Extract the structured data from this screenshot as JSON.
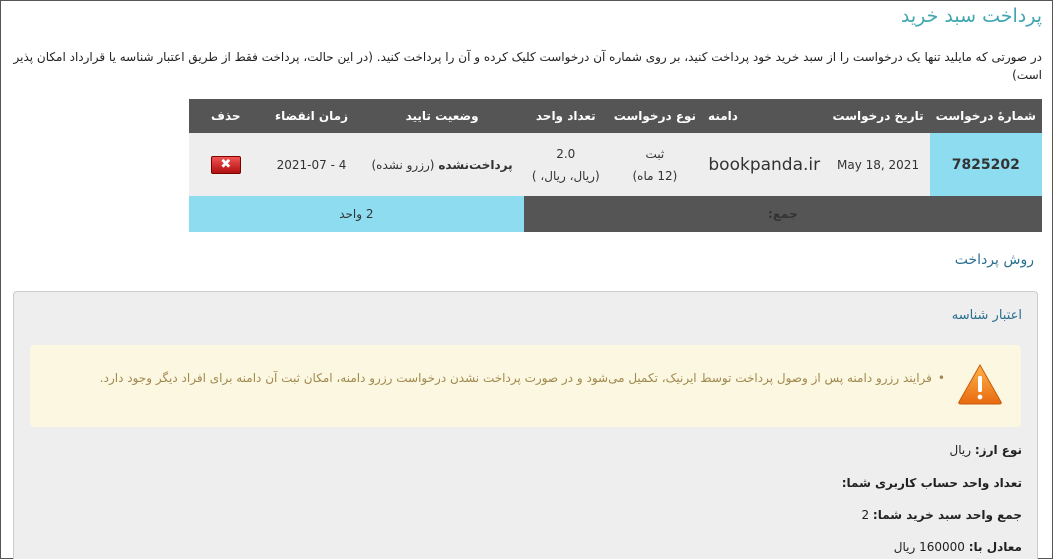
{
  "page": {
    "title": "پرداخت سبد خرید",
    "intro": "در صورتی که مایلید تنها یک درخواست را از سبد خرید خود پرداخت کنید، بر روی شماره آن درخواست کلیک کرده و آن را پرداخت کنید. (در این حالت، پرداخت فقط از طریق اعتبار شناسه یا قرارداد امکان پذیر است)"
  },
  "cart": {
    "headers": [
      "شمارهٔ درخواست",
      "تاریخ درخواست",
      "دامنه",
      "نوع درخواست",
      "تعداد واحد",
      "وضعیت تایید",
      "زمان انقضاء",
      "حذف"
    ],
    "row": {
      "request_id": "7825202",
      "request_date": "May 18, 2021",
      "domain": "bookpanda.ir",
      "request_type": "ثبت",
      "request_period": "(12 ماه)",
      "unit_count": "2.0",
      "unit_currency": "(ریال، ریال، )",
      "status_bold": "پرداخت‌نشده",
      "status_note": "(رزرو نشده)",
      "expiry": "4 - 2021-07",
      "delete_label": "✖"
    },
    "total": {
      "label": "جمع:",
      "value": "2 واحد"
    }
  },
  "payment": {
    "heading": "روش پرداخت",
    "panel_title": "اعتبار شناسه",
    "alert": "فرایند رزرو دامنه پس از وصول پرداخت توسط ایرنیک، تکمیل می‌شود و در صورت پرداخت نشدن درخواست رزرو دامنه، امکان ثبت آن دامنه برای افراد دیگر وجود دارد.",
    "currency_label": "نوع ارز:",
    "currency_value": "ریال",
    "account_units_label": "تعداد واحد حساب کاربری شما:",
    "cart_units_label": "جمع واحد سبد خرید شما:",
    "cart_units_value": "2",
    "equivalent_label": "معادل با:",
    "equivalent_value": "160000 ریال"
  },
  "colors": {
    "title": "#3fa7b0",
    "header_bg": "#555555",
    "highlight": "#8ddcef",
    "alert_bg": "#fcf7e0"
  }
}
